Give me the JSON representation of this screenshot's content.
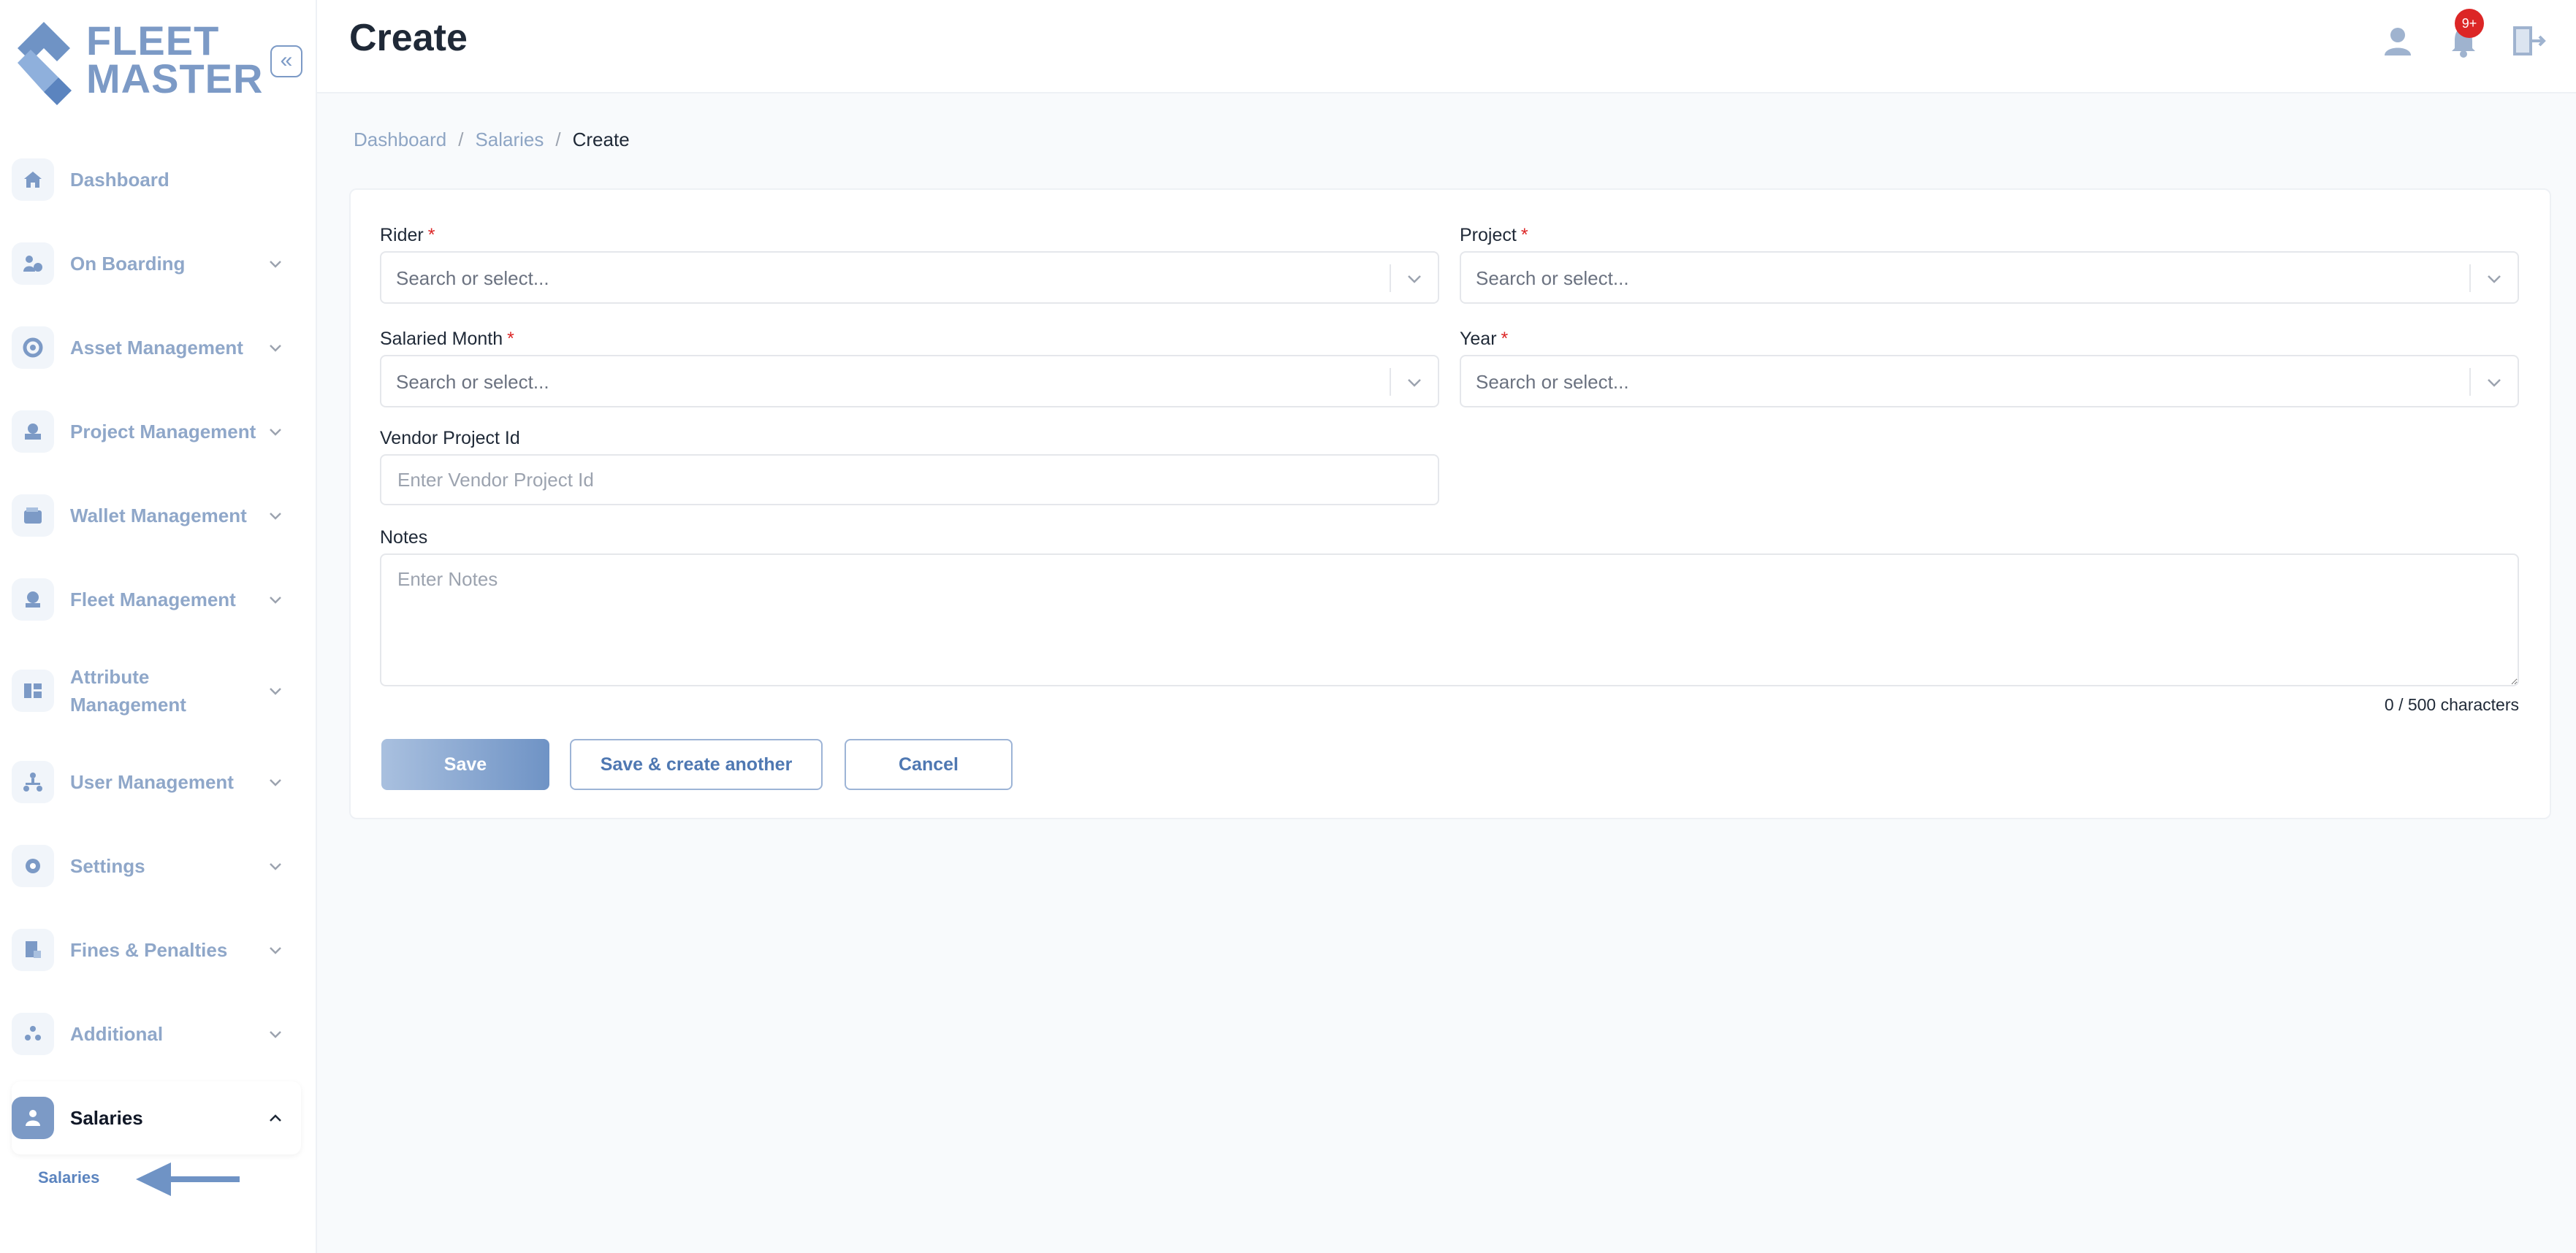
{
  "brand": {
    "line1": "FLEET",
    "line2": "MASTER"
  },
  "sidebar": {
    "collapse_icon": "chevrons-left-icon",
    "items": [
      {
        "label": "Dashboard",
        "icon": "home-icon",
        "expandable": false
      },
      {
        "label": "On Boarding",
        "icon": "onboarding-icon",
        "expandable": true
      },
      {
        "label": "Asset Management",
        "icon": "asset-icon",
        "expandable": true
      },
      {
        "label": "Project Management",
        "icon": "project-icon",
        "expandable": true
      },
      {
        "label": "Wallet Management",
        "icon": "wallet-icon",
        "expandable": true
      },
      {
        "label": "Fleet Management",
        "icon": "fleet-icon",
        "expandable": true
      },
      {
        "label": "Attribute Management",
        "icon": "attribute-icon",
        "expandable": true
      },
      {
        "label": "User Management",
        "icon": "user-tree-icon",
        "expandable": true
      },
      {
        "label": "Settings",
        "icon": "gear-icon",
        "expandable": true
      },
      {
        "label": "Fines & Penalties",
        "icon": "fines-icon",
        "expandable": true
      },
      {
        "label": "Additional",
        "icon": "additional-icon",
        "expandable": true
      },
      {
        "label": "Salaries",
        "icon": "salaries-icon",
        "expandable": true,
        "active": true
      }
    ],
    "sub_items": [
      {
        "label": "Salaries"
      }
    ]
  },
  "header": {
    "title": "Create",
    "notification_count": "9+",
    "icons": [
      "user-icon",
      "bell-icon",
      "logout-icon"
    ]
  },
  "breadcrumb": [
    {
      "label": "Dashboard"
    },
    {
      "label": "Salaries"
    },
    {
      "label": "Create"
    }
  ],
  "form": {
    "rider": {
      "label": "Rider",
      "required": "*",
      "placeholder": "Search or select..."
    },
    "project": {
      "label": "Project",
      "required": "*",
      "placeholder": "Search or select..."
    },
    "salaried_month": {
      "label": "Salaried Month",
      "required": "*",
      "placeholder": "Search or select..."
    },
    "year": {
      "label": "Year",
      "required": "*",
      "placeholder": "Search or select..."
    },
    "vendor_project_id": {
      "label": "Vendor Project Id",
      "placeholder": "Enter Vendor Project Id",
      "value": ""
    },
    "notes": {
      "label": "Notes",
      "placeholder": "Enter Notes",
      "value": "",
      "char_count": "0 / 500 characters"
    },
    "buttons": {
      "save": "Save",
      "save_another": "Save & create another",
      "cancel": "Cancel"
    }
  },
  "colors": {
    "accent": "#7c9ac6",
    "nav_text": "#8fa7c9",
    "required": "#dc2626",
    "badge": "#dc2626"
  }
}
